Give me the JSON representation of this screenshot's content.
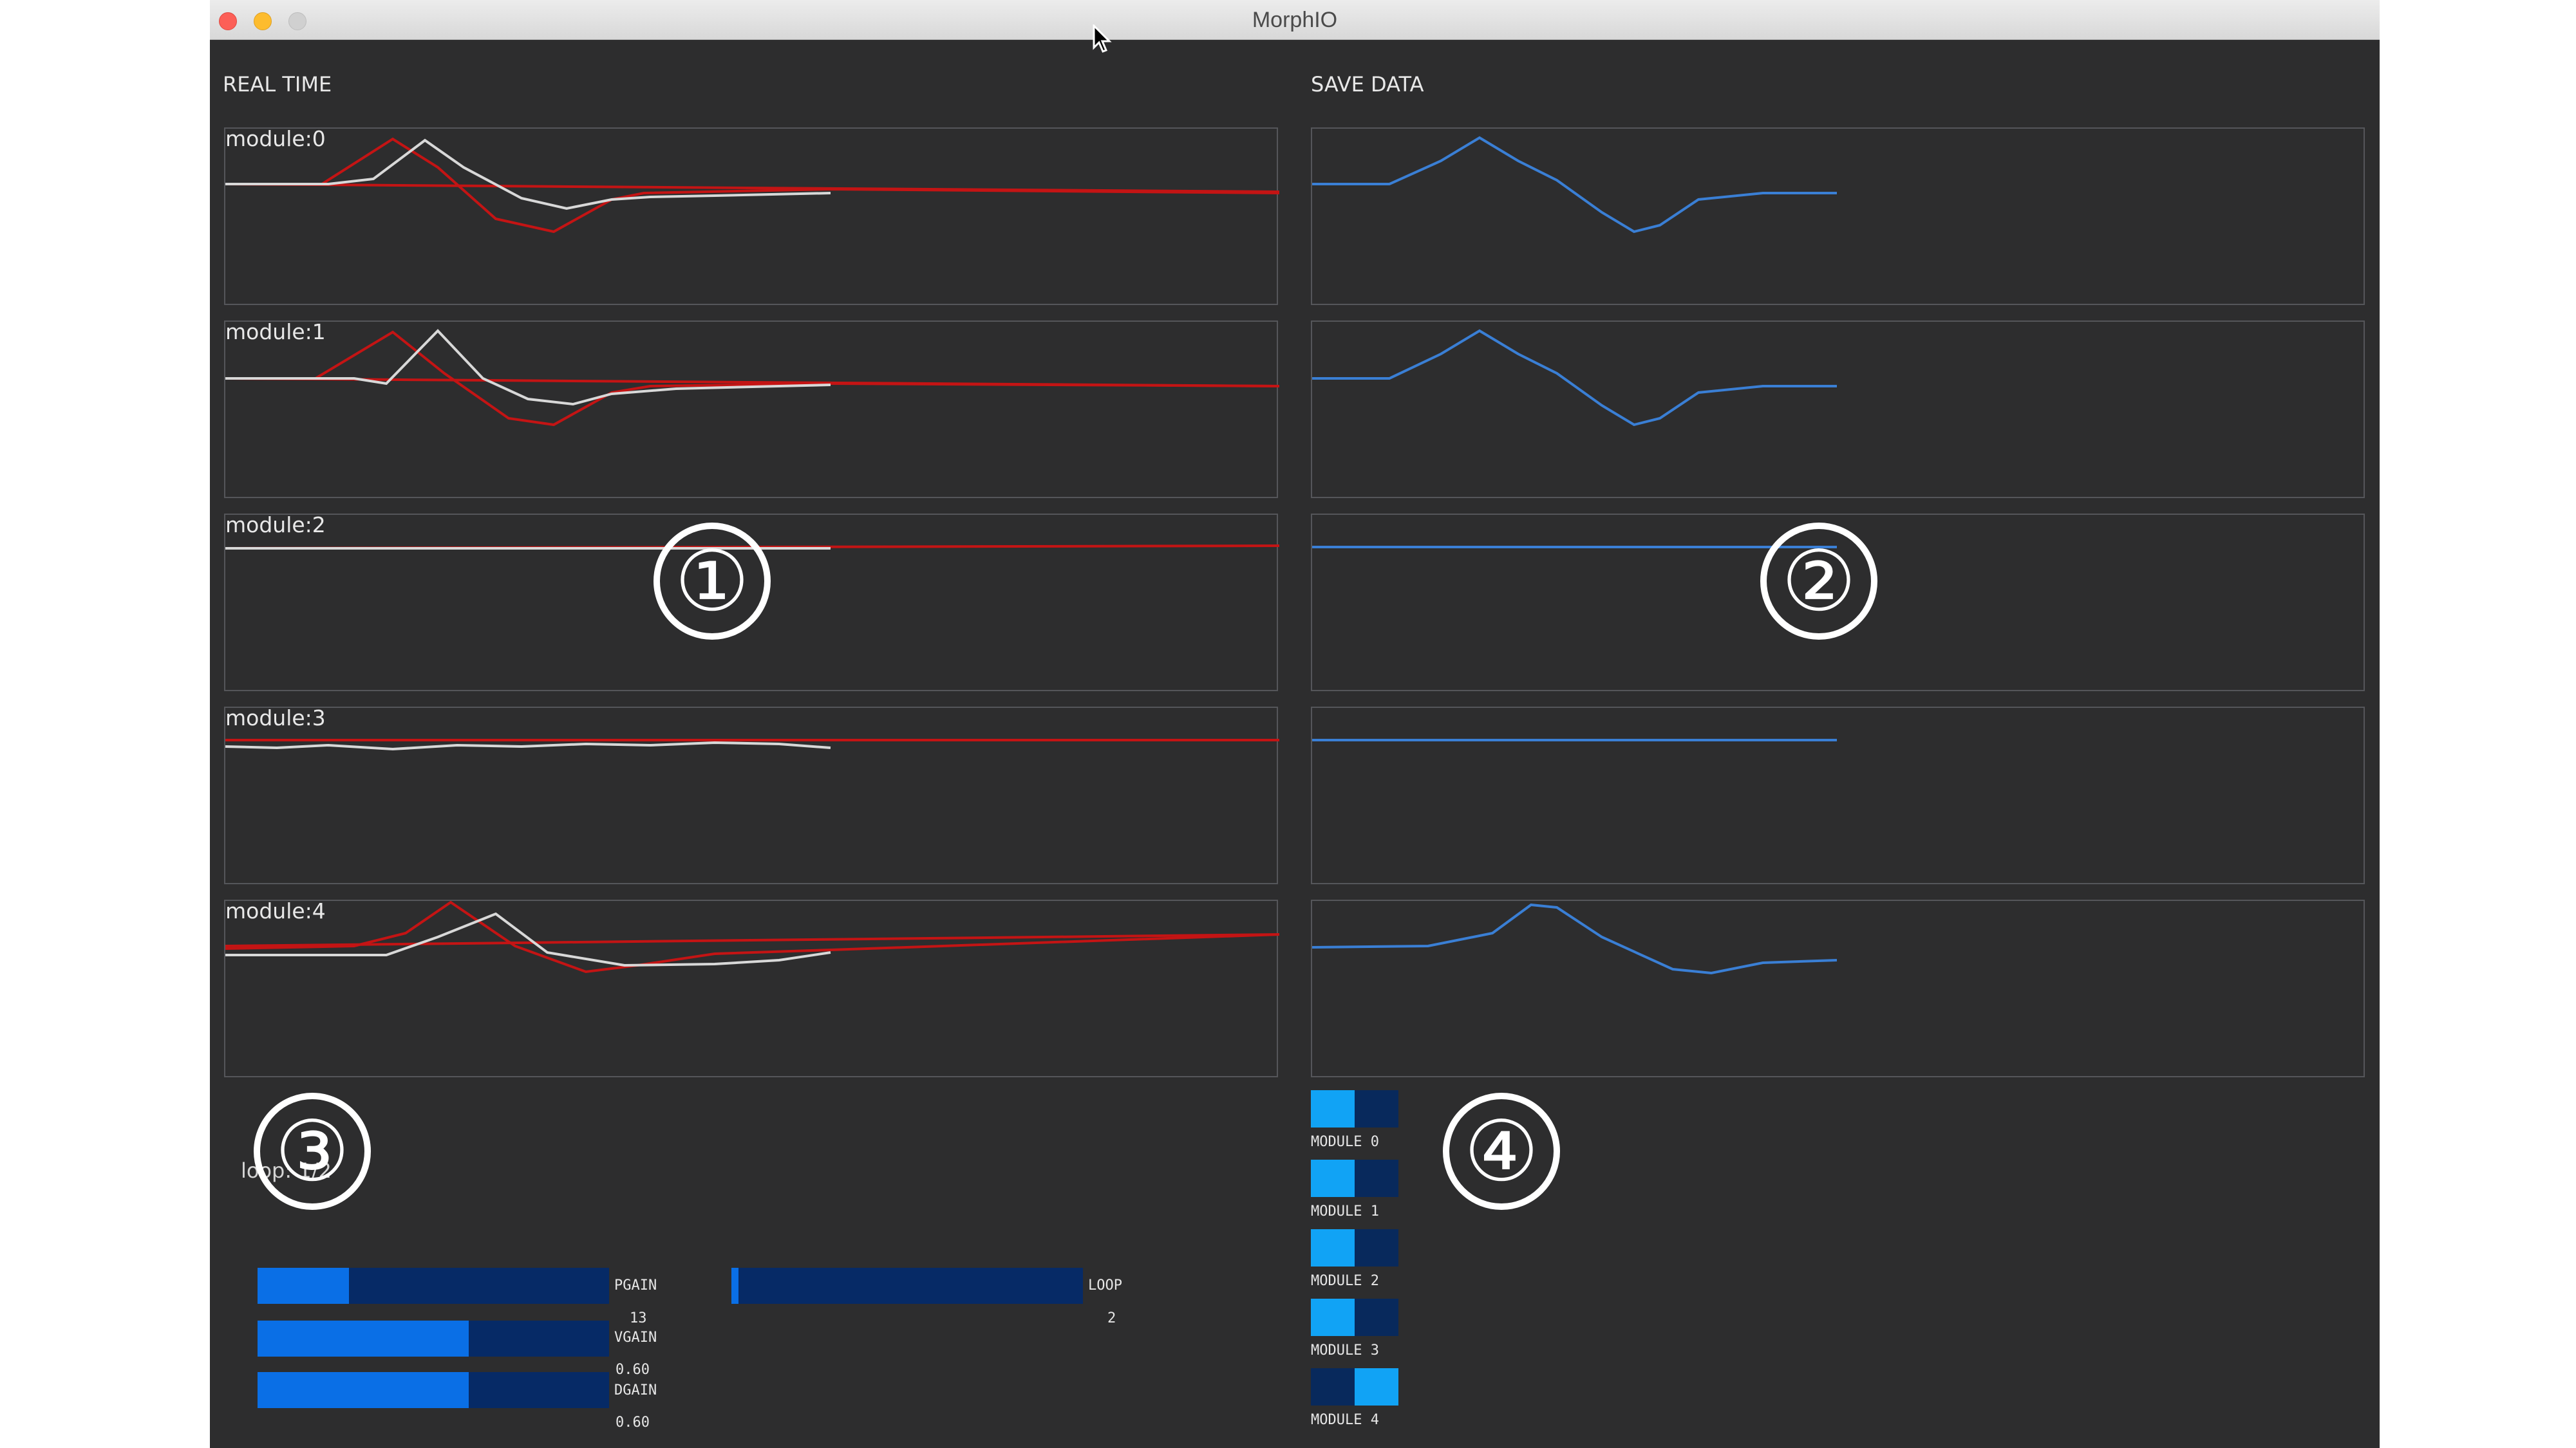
{
  "window": {
    "title": "MorphIO"
  },
  "sections": {
    "realtime": "REAL TIME",
    "savedata": "SAVE DATA"
  },
  "modules": [
    {
      "label": "module:0"
    },
    {
      "label": "module:1"
    },
    {
      "label": "module:2"
    },
    {
      "label": "module:3"
    },
    {
      "label": "module:4"
    }
  ],
  "callouts": [
    "①",
    "②",
    "③",
    "④"
  ],
  "loop_status": "loop: 1/2",
  "sliders": {
    "pgain": {
      "label": "PGAIN",
      "value": "13",
      "fraction": 0.26
    },
    "vgain": {
      "label": "VGAIN",
      "value": "0.60",
      "fraction": 0.6
    },
    "dgain": {
      "label": "DGAIN",
      "value": "0.60",
      "fraction": 0.6
    },
    "loop": {
      "label": "LOOP",
      "value": "2",
      "fraction": 0.02
    }
  },
  "toggles": [
    {
      "label": "MODULE 0",
      "state": "off"
    },
    {
      "label": "MODULE 1",
      "state": "off"
    },
    {
      "label": "MODULE 2",
      "state": "off"
    },
    {
      "label": "MODULE 3",
      "state": "off"
    },
    {
      "label": "MODULE 4",
      "state": "on"
    }
  ],
  "colors": {
    "realtime_target": "#c41414",
    "realtime_measured": "#d8d8d8",
    "saved": "#3a7fd5",
    "slider_fill": "#0a6fe6",
    "slider_track": "#062a66",
    "toggle_knob": "#11a3f5"
  }
}
